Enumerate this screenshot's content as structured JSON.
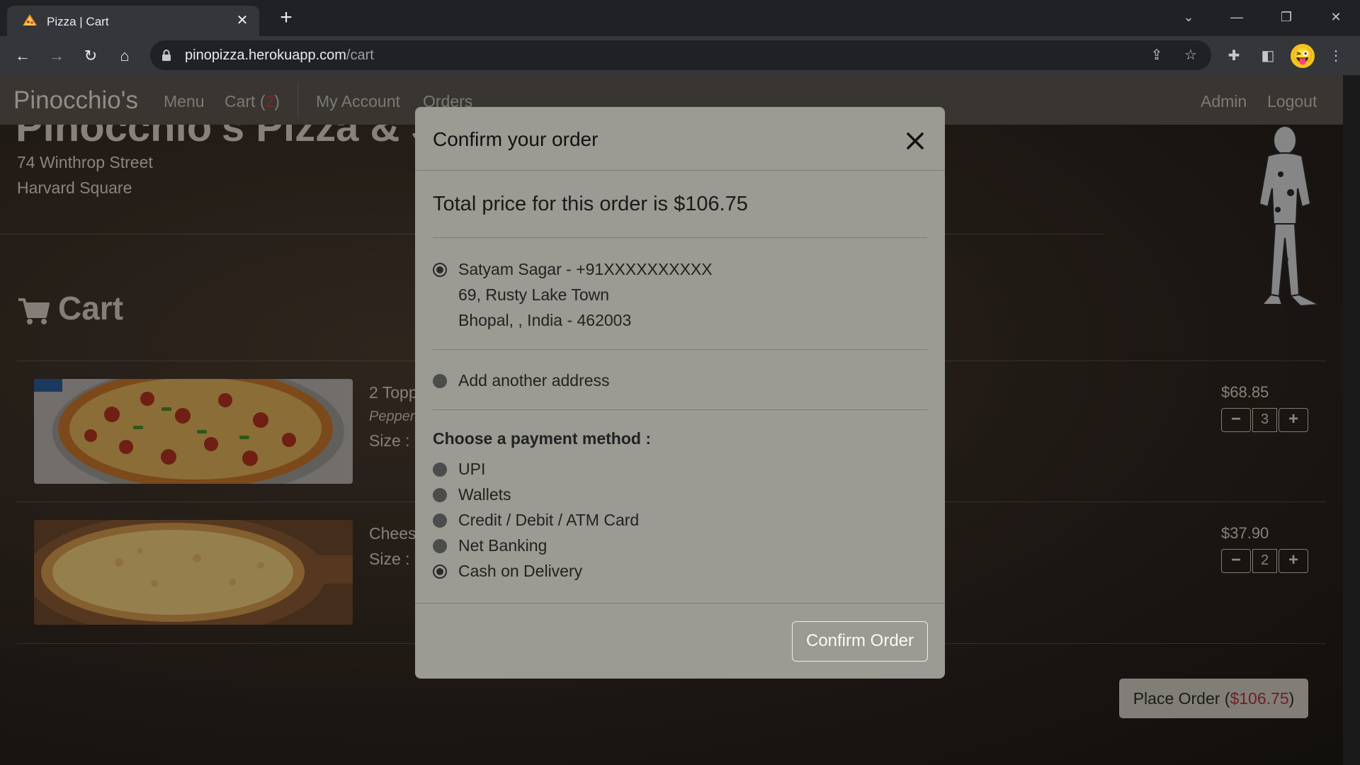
{
  "browser": {
    "tab_title": "Pizza | Cart",
    "url_host": "pinopizza.herokuapp.com",
    "url_path": "/cart"
  },
  "site": {
    "brand": "Pinocchio's",
    "nav_left": [
      "Menu",
      "Cart (",
      "2",
      ")",
      "My Account",
      "Orders"
    ],
    "nav_right": [
      "Admin",
      "Logout"
    ],
    "hero_title": "Pinocchio's Pizza & Subs",
    "address_line1": "74 Winthrop Street",
    "address_line2": "Harvard Square",
    "cart_heading": "Cart"
  },
  "cart_items": [
    {
      "name": "2 Topp",
      "sub": "Pepperc",
      "size_label": "Size : I",
      "price": "$68.85",
      "quantity": "3",
      "image": "pepperoni-pizza"
    },
    {
      "name": "Chees",
      "sub": "",
      "size_label": "Size : I",
      "price": "$37.90",
      "quantity": "2",
      "image": "cheese-pizza"
    }
  ],
  "place_order": {
    "prefix": "Place Order (",
    "amount": "$106.75",
    "suffix": ")"
  },
  "modal": {
    "title": "Confirm your order",
    "total_text": "Total price for this order is $106.75",
    "address": {
      "selected": true,
      "line1": "Satyam Sagar - +91XXXXXXXXXX",
      "line2": "69, Rusty Lake Town",
      "line3": "Bhopal, , India - 462003"
    },
    "add_address_label": "Add another address",
    "payment_heading": "Choose a payment method :",
    "payment_methods": [
      {
        "label": "UPI",
        "selected": false
      },
      {
        "label": "Wallets",
        "selected": false
      },
      {
        "label": "Credit / Debit / ATM Card",
        "selected": false
      },
      {
        "label": "Net Banking",
        "selected": false
      },
      {
        "label": "Cash on Delivery",
        "selected": true
      }
    ],
    "confirm_label": "Confirm Order"
  },
  "colors": {
    "accent_red": "#b1333f",
    "modal_bg": "#9b9a93",
    "navbar_bg": "#5c5850"
  }
}
